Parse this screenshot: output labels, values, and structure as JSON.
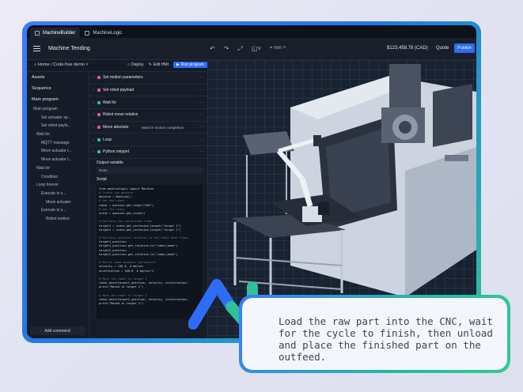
{
  "tabs": [
    {
      "label": "MachineBuilder",
      "active": true
    },
    {
      "label": "MachineLogic",
      "active": false
    }
  ],
  "toolbar": {
    "project_title": "Machine Tending",
    "unit": "mm",
    "price": "$123,458.78 (CAD)",
    "quote_label": "Quote",
    "publish_label": "Publish"
  },
  "breadcrumb": {
    "home": "Home",
    "separator": "/",
    "current": "Code-free demo"
  },
  "subheader": {
    "deploy": "Deploy",
    "edit_hmi": "Edit HMI",
    "run": "Run program"
  },
  "left": {
    "sections": [
      "Assets",
      "Sequence",
      "Main program"
    ],
    "tree": [
      "Main program",
      "Set actuator sp...",
      "Set robot paylo...",
      "Wait for",
      "MQTT message",
      "Move actuator t...",
      "Move actuator t...",
      "Wait for",
      "Condition",
      "Loop forever",
      "Execute in s...",
      "Move actuator",
      "Execute in s...",
      "Robot motion"
    ],
    "add_command": "Add command"
  },
  "commands": [
    {
      "label": "Set motion parameters",
      "color": "#e0559b",
      "extra": ""
    },
    {
      "label": "Set robot payload",
      "color": "#e0559b",
      "extra": ""
    },
    {
      "label": "Wait for",
      "color": "#2bbfa0",
      "extra": ""
    },
    {
      "label": "Robot move relative",
      "color": "#e0559b",
      "extra": ""
    },
    {
      "label": "Move absolute",
      "color": "#e0559b",
      "extra": "Wait for motion completion"
    },
    {
      "label": "Loop",
      "color": "#2bbfa0",
      "extra": ""
    },
    {
      "label": "Python snippet",
      "color": "#2bbfa0",
      "extra": ""
    }
  ],
  "output_variable": {
    "label": "Output variable",
    "value": "None"
  },
  "script": {
    "label": "Script",
    "lines": [
      "from machinelogic import Machine",
      "# Create the machine",
      "machine = Machine()",
      "# Get the robot",
      "robot = machine.get_robot(\"UR3\")",
      "# Get the scene",
      "scene = machine.get_scene()",
      "",
      "# Retrieve the calibrated frame",
      "target1 = scene.get_cartesian_target(\"target 1\")",
      "target2 = scene.get_cartesian_target(\"target 2\")",
      "",
      "# Retrieve position relative to the robot base frame",
      "target1_position",
      "target1_position.get_relative_to(\"robot_base\")",
      "target2_position",
      "target2_position.get_relative_to(\"robot_base\")",
      "",
      "# Define some movement parameters",
      "velocity = 150.0  # mm/sec",
      "acceleration = 100.0  # mm/sec^2",
      "",
      "# Move the robot to target 1",
      "robot.move(target1_position, velocity, acceleration)",
      "print(\"Moved to target 1\")",
      "",
      "# Move the robot to target 2",
      "robot.move(target2_position, velocity, acceleration)",
      "print(\"Moved to target 2\")"
    ]
  },
  "caption": "Load the raw part into the CNC, wait for the cycle to finish, then unload and place the finished part on the outfeed."
}
